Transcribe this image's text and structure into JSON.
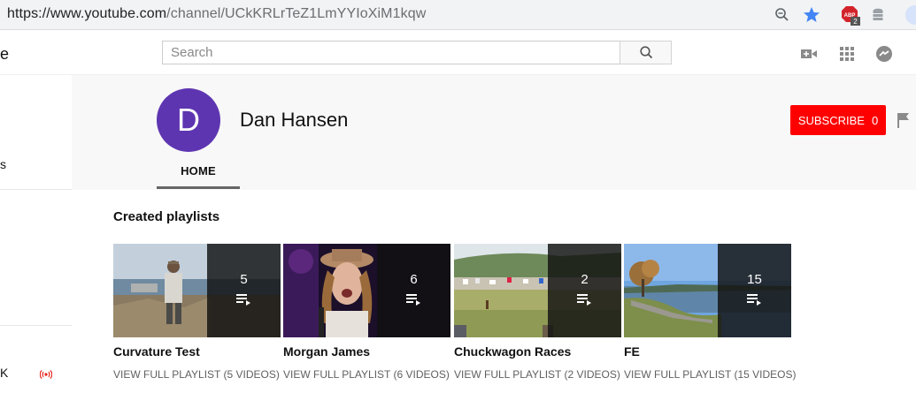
{
  "browser": {
    "url_host": "https://www.youtube.com",
    "url_path": "/channel/UCkKRLrTeZ1LmYYIoXiM1kqw",
    "abp_badge": "2"
  },
  "masthead": {
    "logo_fragment": "e",
    "search_placeholder": "Search"
  },
  "sidebar": {
    "items": [
      {
        "label": "s"
      },
      {
        "label": "K"
      }
    ]
  },
  "channel": {
    "avatar_letter": "D",
    "avatar_color": "#5e35b1",
    "name": "Dan Hansen",
    "subscribe_label": "SUBSCRIBE",
    "subscriber_count": "0",
    "tabs": [
      {
        "label": "HOME"
      }
    ]
  },
  "section": {
    "title": "Created playlists"
  },
  "playlists": [
    {
      "title": "Curvature Test",
      "count": "5",
      "link": "VIEW FULL PLAYLIST (5 VIDEOS)"
    },
    {
      "title": "Morgan James",
      "count": "6",
      "link": "VIEW FULL PLAYLIST (6 VIDEOS)"
    },
    {
      "title": "Chuckwagon Races",
      "count": "2",
      "link": "VIEW FULL PLAYLIST (2 VIDEOS)"
    },
    {
      "title": "FE",
      "count": "15",
      "link": "VIEW FULL PLAYLIST (15 VIDEOS)"
    }
  ],
  "colors": {
    "subscribe": "#ff0000",
    "header_bg": "#f8f8f8",
    "star": "#4285f4",
    "live": "#e62117"
  },
  "icons": [
    "zoom-icon",
    "bookmark-star-icon",
    "adblock-icon",
    "extension-stack-icon",
    "profile-icon",
    "search-icon",
    "create-video-icon",
    "apps-grid-icon",
    "messages-icon",
    "flag-icon",
    "playlist-icon",
    "live-icon"
  ]
}
